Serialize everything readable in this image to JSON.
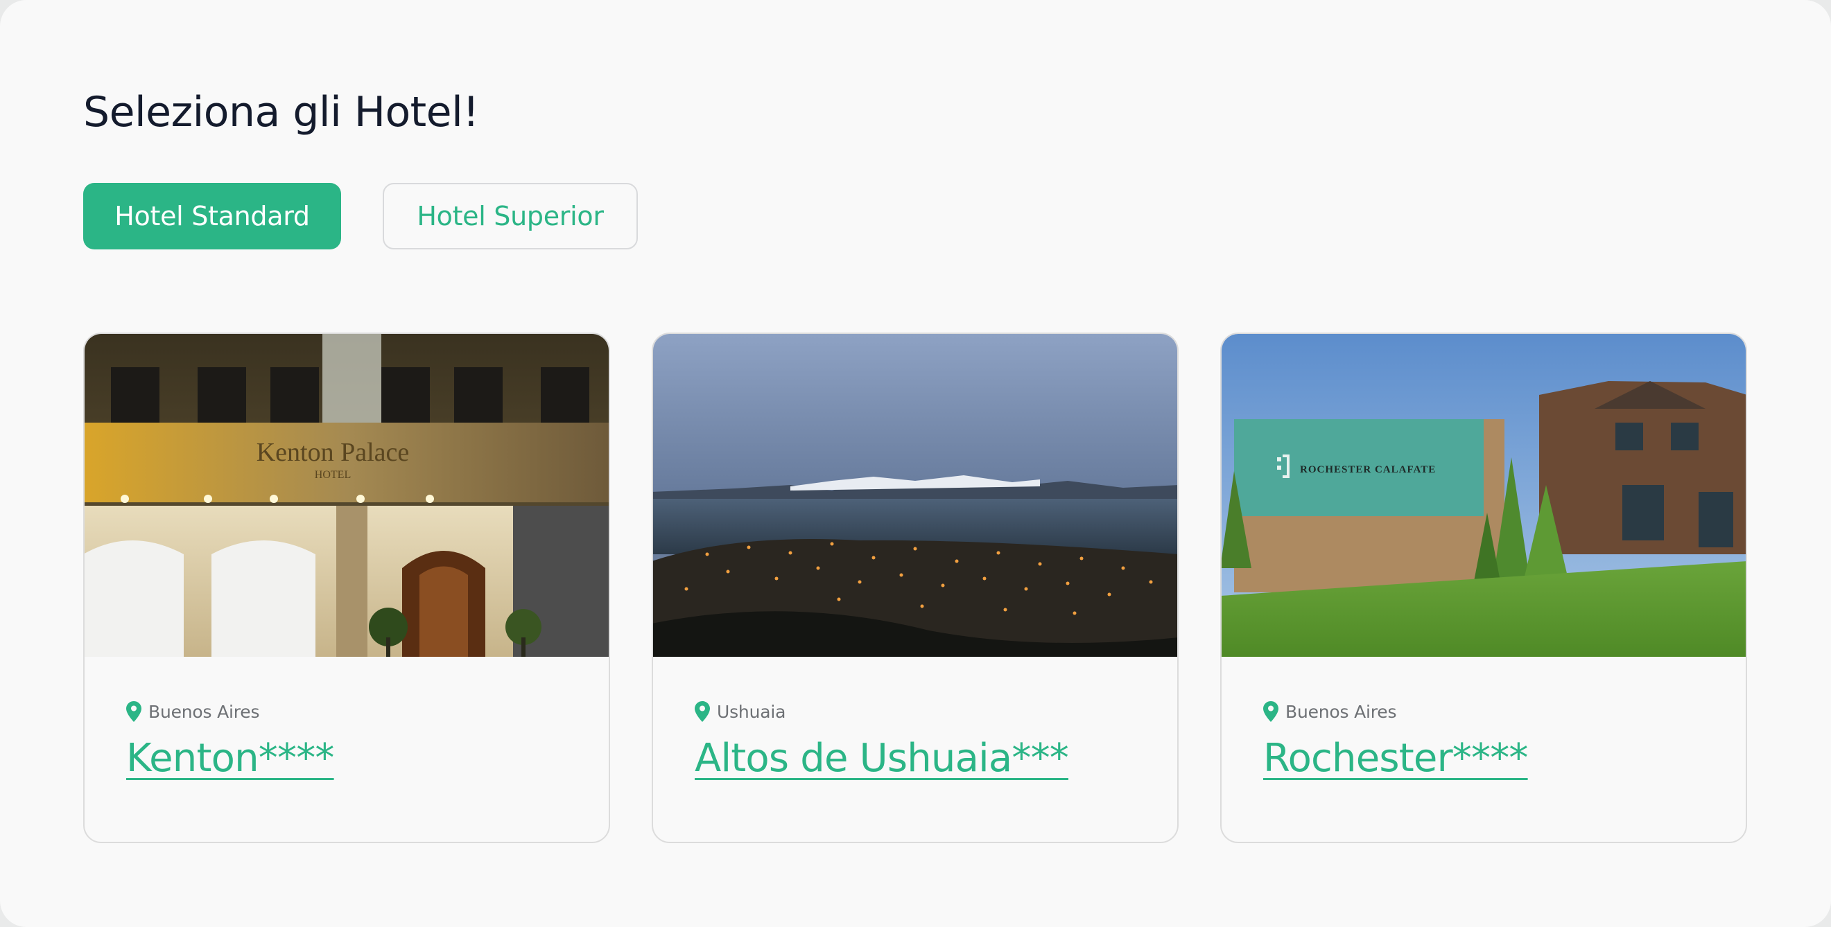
{
  "page": {
    "title": "Seleziona gli Hotel!"
  },
  "tabs": [
    {
      "label": "Hotel Standard",
      "active": true
    },
    {
      "label": "Hotel Superior",
      "active": false
    }
  ],
  "hotels": [
    {
      "location": "Buenos Aires",
      "name": "Kenton****",
      "photo_sign": "Kenton Palace",
      "photo_sign_sub": "HOTEL"
    },
    {
      "location": "Ushuaia",
      "name": "Altos de Ushuaia***"
    },
    {
      "location": "Buenos Aires",
      "name": "Rochester****",
      "photo_sign": "ROCHESTER CALAFATE"
    }
  ],
  "colors": {
    "accent": "#2bb586",
    "title": "#141b2d",
    "muted": "#6e7175",
    "background": "#f9f9f9",
    "border": "#dcdcdc"
  },
  "icons": {
    "location": "map-pin-icon"
  }
}
